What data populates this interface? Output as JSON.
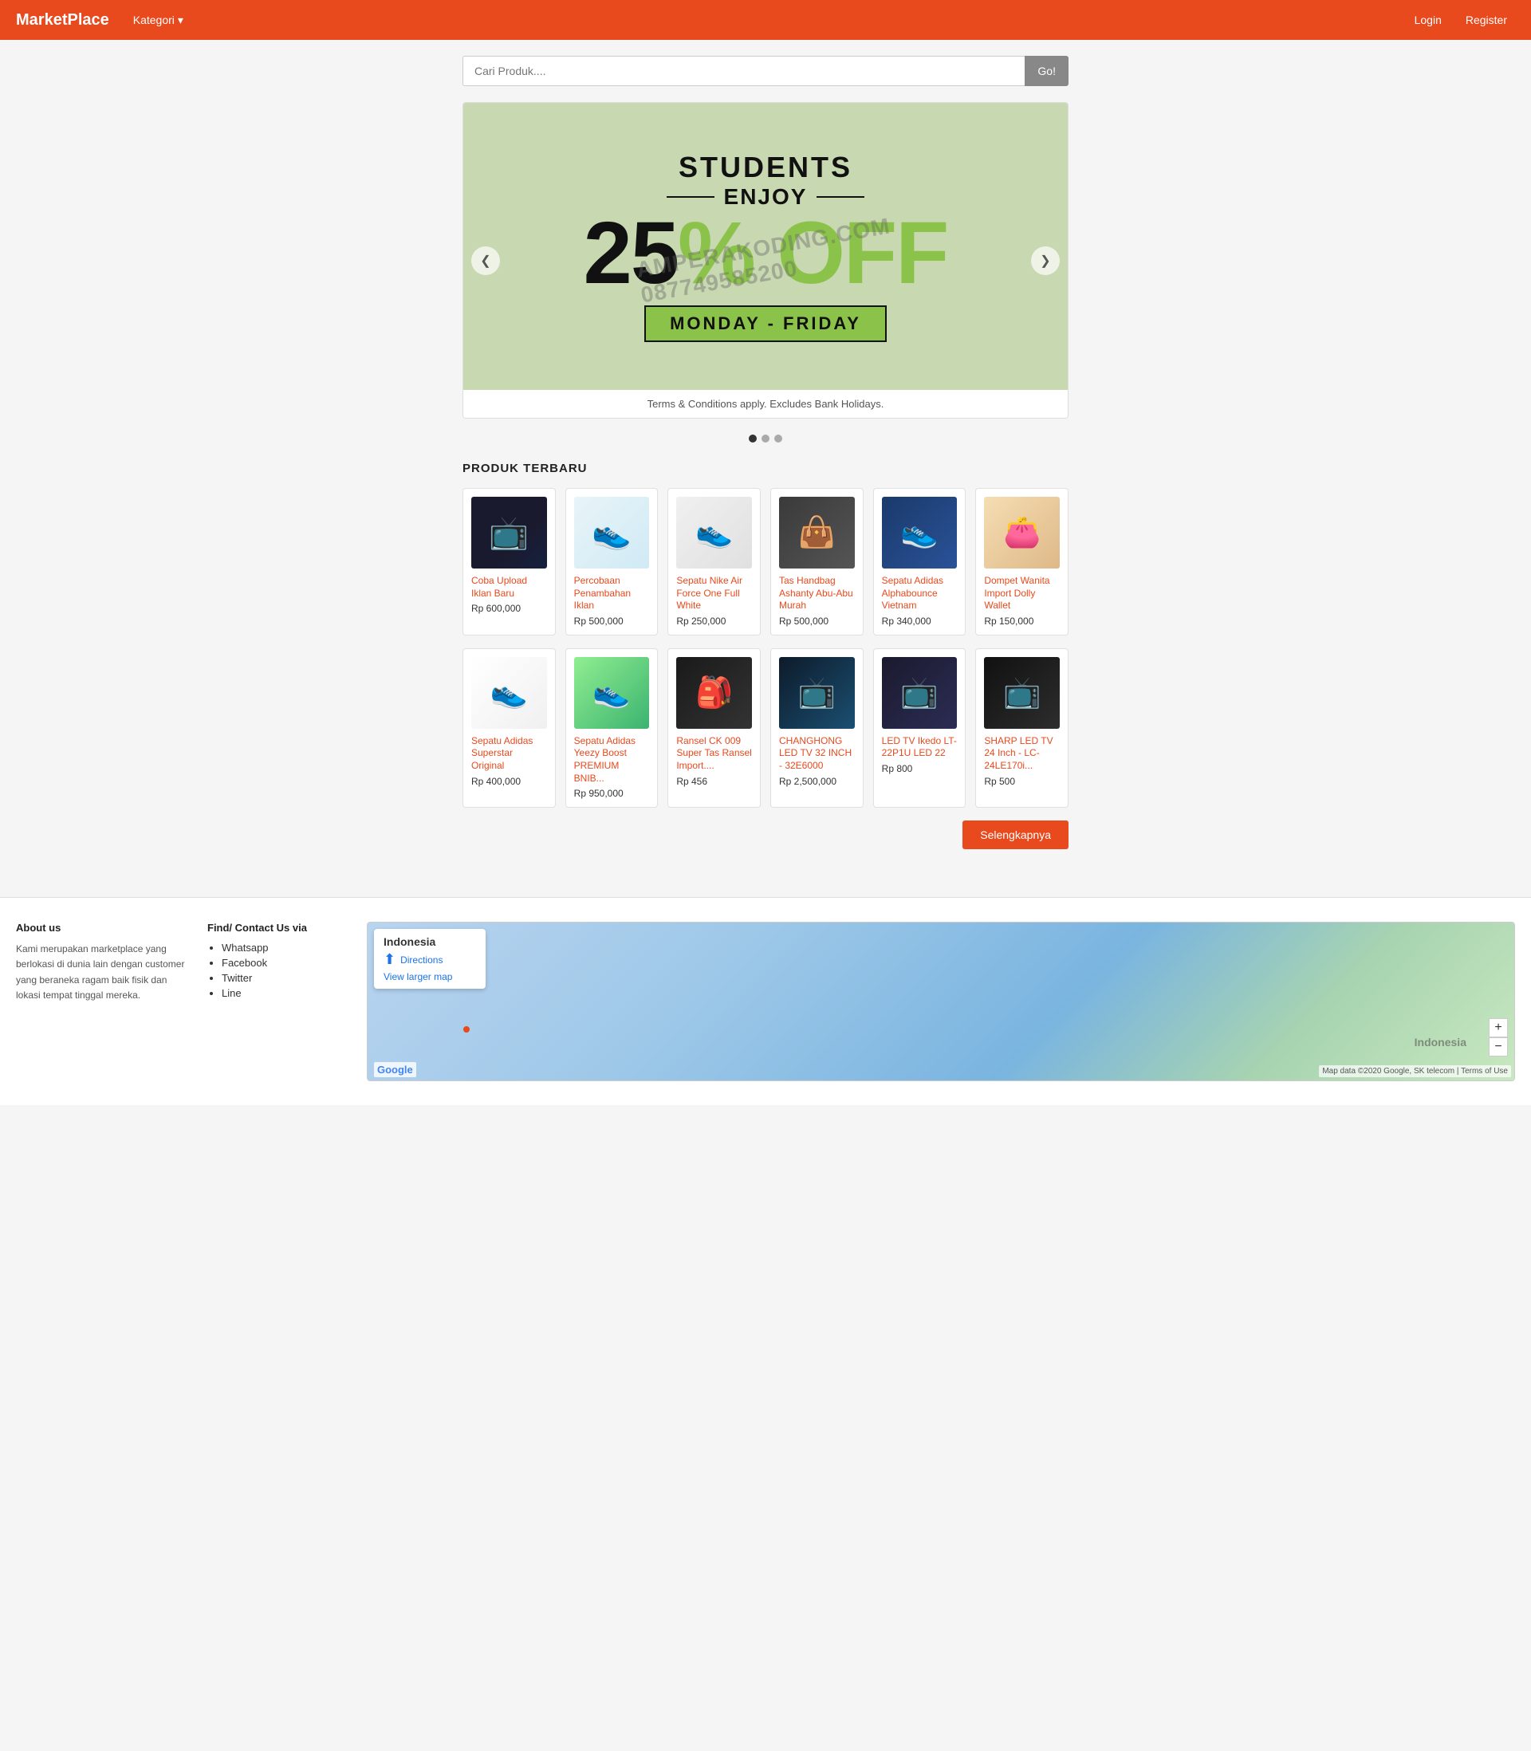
{
  "navbar": {
    "brand": "MarketPlace",
    "kategori_label": "Kategori",
    "chevron": "▾",
    "login_label": "Login",
    "register_label": "Register"
  },
  "search": {
    "placeholder": "Cari Produk....",
    "button_label": "Go!"
  },
  "banner": {
    "line1": "STUDENTS",
    "line2": "ENJOY",
    "line3": "25% OFF",
    "line4": "MONDAY - FRIDAY",
    "footer": "Terms & Conditions apply. Excludes Bank Holidays.",
    "prev_label": "❮",
    "next_label": "❯",
    "dots": [
      {
        "active": true
      },
      {
        "active": false
      },
      {
        "active": false
      }
    ]
  },
  "products_section": {
    "title": "PRODUK TERBARU",
    "more_button": "Selengkapnya",
    "rows": [
      [
        {
          "title": "Coba Upload Iklan Baru",
          "price": "Rp 600,000",
          "img_class": "img-tv"
        },
        {
          "title": "Percobaan Penambahan Iklan",
          "price": "Rp 500,000",
          "img_class": "img-shoe-white"
        },
        {
          "title": "Sepatu Nike Air Force One Full White",
          "price": "Rp 250,000",
          "img_class": "img-shoe-nike"
        },
        {
          "title": "Tas Handbag Ashanty Abu-Abu Murah",
          "price": "Rp 500,000",
          "img_class": "img-bag"
        },
        {
          "title": "Sepatu Adidas Alphabounce Vietnam",
          "price": "Rp 340,000",
          "img_class": "img-shoe-blue"
        },
        {
          "title": "Dompet Wanita Import Dolly Wallet",
          "price": "Rp 150,000",
          "img_class": "img-wallet"
        }
      ],
      [
        {
          "title": "Sepatu Adidas Superstar Original",
          "price": "Rp 400,000",
          "img_class": "img-adidas-w"
        },
        {
          "title": "Sepatu Adidas Yeezy Boost PREMIUM BNIB...",
          "price": "Rp 950,000",
          "img_class": "img-yeezy"
        },
        {
          "title": "Ransel CK 009 Super Tas Ransel Import....",
          "price": "Rp 456",
          "img_class": "img-backpack"
        },
        {
          "title": "CHANGHONG LED TV 32 INCH - 32E6000",
          "price": "Rp 2,500,000",
          "img_class": "img-tv2"
        },
        {
          "title": "LED TV Ikedo LT-22P1U LED 22",
          "price": "Rp 800",
          "img_class": "img-tv3"
        },
        {
          "title": "SHARP LED TV 24 Inch - LC-24LE170i...",
          "price": "Rp 500",
          "img_class": "img-tv4"
        }
      ]
    ]
  },
  "footer": {
    "about_title": "About us",
    "about_text": "Kami merupakan marketplace yang berlokasi di dunia lain dengan customer yang beraneka ragam baik fisik dan lokasi tempat tinggal mereka.",
    "contact_title": "Find/ Contact Us via",
    "contact_items": [
      "Whatsapp",
      "Facebook",
      "Twitter",
      "Line"
    ],
    "map_country": "Indonesia",
    "map_directions": "Directions",
    "map_view_larger": "View larger map",
    "map_label": "Indonesia",
    "map_zoom_in": "+",
    "map_zoom_out": "−",
    "map_google_logo": "Google",
    "map_footer_text": "Map data ©2020 Google, SK telecom | Terms of Use"
  },
  "watermark": "AMPERAKODING.COM\n087749585200"
}
